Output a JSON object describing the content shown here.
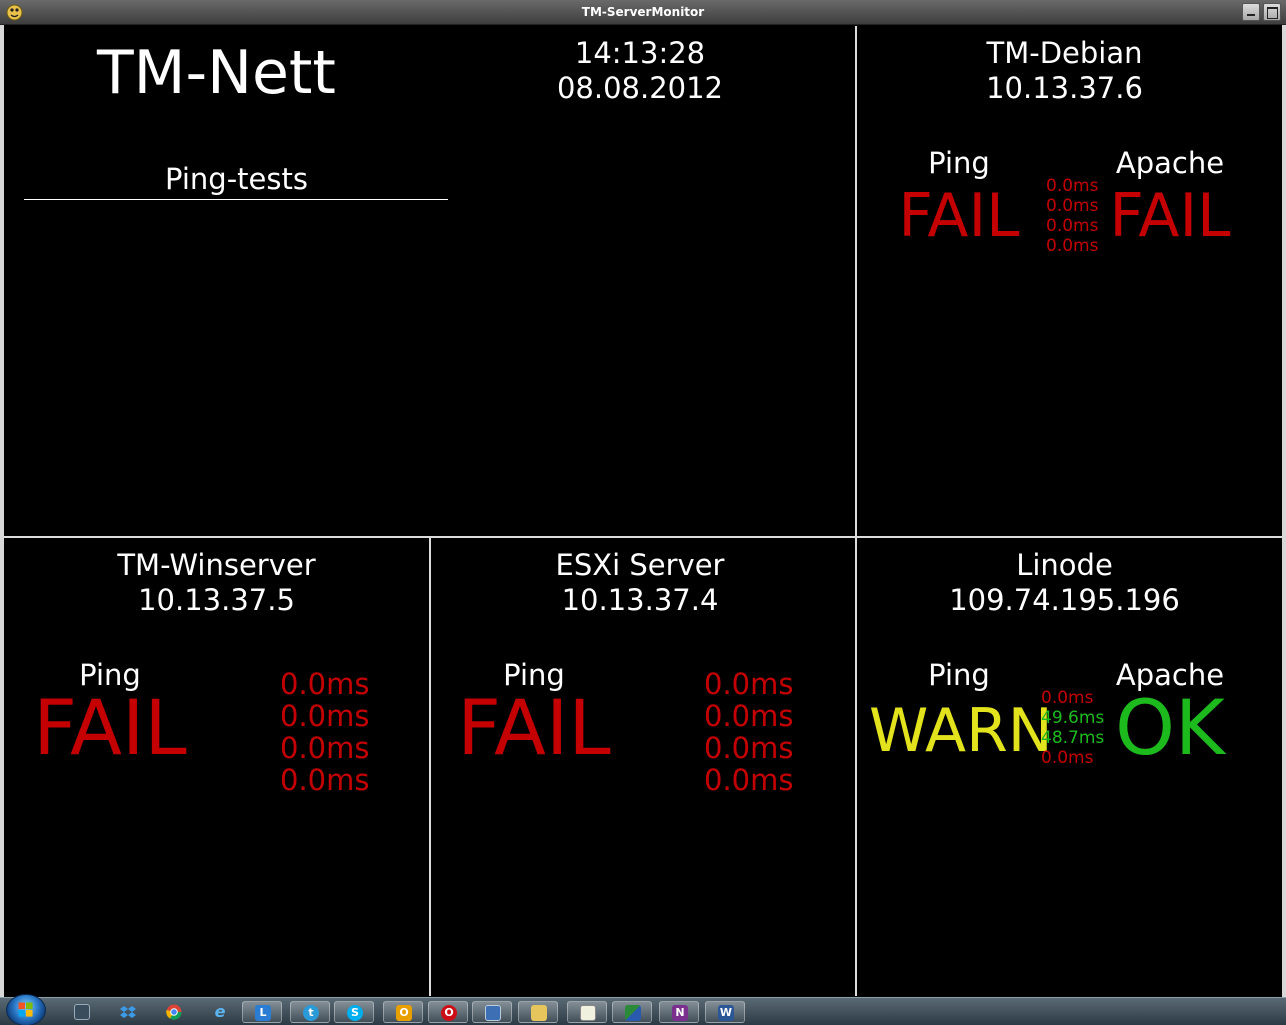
{
  "window": {
    "title": "TM-ServerMonitor"
  },
  "header": {
    "brand": "TM-Nett",
    "time": "14:13:28",
    "date": "08.08.2012",
    "section_title": "Ping-tests"
  },
  "servers": {
    "debian": {
      "name": "TM-Debian",
      "ip": "10.13.37.6",
      "ping_label": "Ping",
      "ping_status": "FAIL",
      "apache_label": "Apache",
      "apache_status": "FAIL",
      "pings": [
        "0.0ms",
        "0.0ms",
        "0.0ms",
        "0.0ms"
      ]
    },
    "winserver": {
      "name": "TM-Winserver",
      "ip": "10.13.37.5",
      "ping_label": "Ping",
      "ping_status": "FAIL",
      "pings": [
        "0.0ms",
        "0.0ms",
        "0.0ms",
        "0.0ms"
      ]
    },
    "esxi": {
      "name": "ESXi Server",
      "ip": "10.13.37.4",
      "ping_label": "Ping",
      "ping_status": "FAIL",
      "pings": [
        "0.0ms",
        "0.0ms",
        "0.0ms",
        "0.0ms"
      ]
    },
    "linode": {
      "name": "Linode",
      "ip": "109.74.195.196",
      "ping_label": "Ping",
      "ping_status": "WARN",
      "apache_label": "Apache",
      "apache_status": "OK",
      "pings": [
        "0.0ms",
        "49.6ms",
        "48.7ms",
        "0.0ms"
      ]
    }
  },
  "colors": {
    "fail": "#c40000",
    "ok": "#1dba1d",
    "warn": "#e3e31d",
    "background": "#000000"
  },
  "taskbar": {
    "icons": [
      {
        "name": "start-orb"
      },
      {
        "name": "network-icon"
      },
      {
        "name": "dropbox-icon"
      },
      {
        "name": "chrome-icon"
      },
      {
        "name": "internet-explorer-icon",
        "glyph": "e"
      },
      {
        "name": "lync-icon",
        "glyph": "L"
      },
      {
        "name": "tweetdeck-icon",
        "glyph": "t"
      },
      {
        "name": "skype-icon",
        "glyph": "S"
      },
      {
        "name": "outlook-icon",
        "glyph": "O"
      },
      {
        "name": "opera-icon",
        "glyph": "O"
      },
      {
        "name": "virtualbox-icon"
      },
      {
        "name": "explorer-folder-icon"
      },
      {
        "name": "notepad-icon"
      },
      {
        "name": "network-map-icon"
      },
      {
        "name": "onenote-icon",
        "glyph": "N"
      },
      {
        "name": "word-icon",
        "glyph": "W"
      }
    ]
  }
}
